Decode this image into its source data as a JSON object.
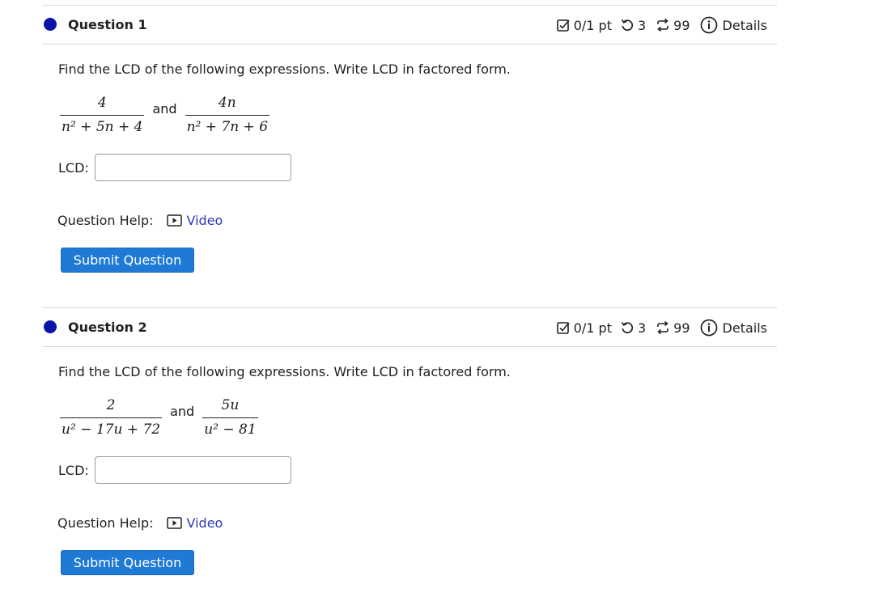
{
  "questions": [
    {
      "title": "Question 1",
      "score": "0/1 pt",
      "attempts": "3",
      "tries": "99",
      "details_label": "Details",
      "prompt": "Find the LCD of the following expressions. Write LCD in factored form.",
      "expr1_num": "4",
      "expr1_den": "n² + 5n + 4",
      "and_word": "and",
      "expr2_num": "4n",
      "expr2_den": "n² + 7n + 6",
      "lcd_label": "LCD:",
      "lcd_value": "",
      "help_label": "Question Help:",
      "video_label": "Video",
      "submit_label": "Submit Question"
    },
    {
      "title": "Question 2",
      "score": "0/1 pt",
      "attempts": "3",
      "tries": "99",
      "details_label": "Details",
      "prompt": "Find the LCD of the following expressions. Write LCD in factored form.",
      "expr1_num": "2",
      "expr1_den": "u² − 17u + 72",
      "and_word": "and",
      "expr2_num": "5u",
      "expr2_den": "u² − 81",
      "lcd_label": "LCD:",
      "lcd_value": "",
      "help_label": "Question Help:",
      "video_label": "Video",
      "submit_label": "Submit Question"
    }
  ],
  "icons": {
    "status_dot": "status-dot-icon",
    "score": "checkbox-edit-icon",
    "attempts": "retry-icon",
    "tries": "repeat-icon",
    "details": "info-circle-icon",
    "video": "play-box-icon"
  },
  "colors": {
    "status_dot": "#0a15a8",
    "submit_button": "#1f7ad6",
    "link": "#2b39b8"
  }
}
